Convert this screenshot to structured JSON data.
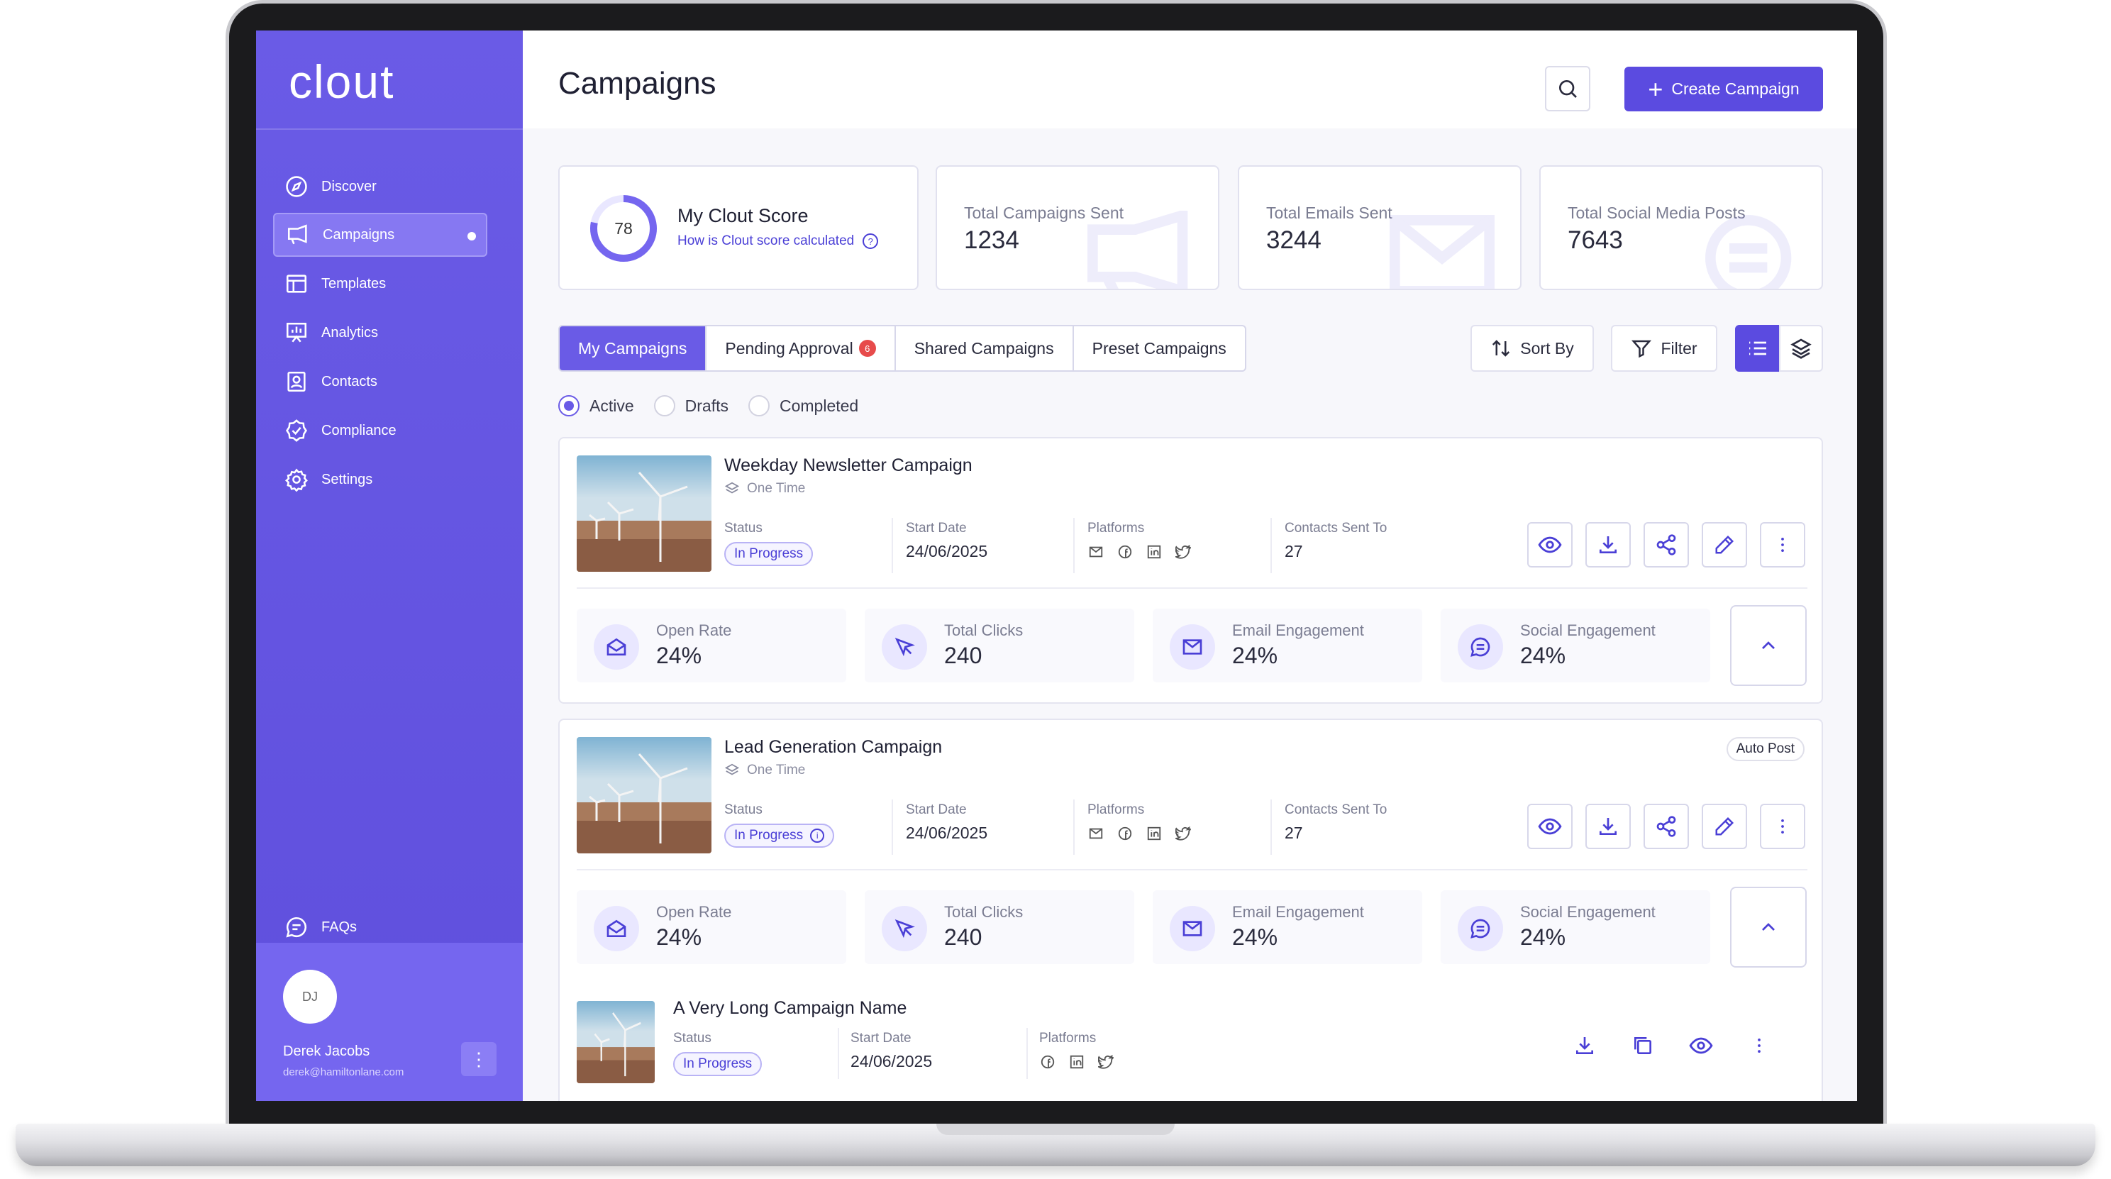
{
  "app": {
    "logo": "clout"
  },
  "sidebar": {
    "items": [
      {
        "label": "Discover",
        "icon": "compass-icon"
      },
      {
        "label": "Campaigns",
        "icon": "megaphone-icon",
        "active": true
      },
      {
        "label": "Templates",
        "icon": "layout-icon"
      },
      {
        "label": "Analytics",
        "icon": "presentation-chart-icon"
      },
      {
        "label": "Contacts",
        "icon": "contact-book-icon"
      },
      {
        "label": "Compliance",
        "icon": "badge-check-icon"
      },
      {
        "label": "Settings",
        "icon": "gear-icon"
      }
    ],
    "faqs": {
      "label": "FAQs",
      "icon": "chat-bubble-icon"
    },
    "user": {
      "initials": "DJ",
      "name": "Derek Jacobs",
      "email": "derek@hamiltonlane.com",
      "menu": "⋮"
    }
  },
  "header": {
    "title": "Campaigns",
    "create_label": "Create Campaign"
  },
  "score": {
    "value": "78",
    "percent": 78,
    "title": "My Clout Score",
    "link": "How is Clout score calculated",
    "help": "?"
  },
  "stats": [
    {
      "label": "Total Campaigns Sent",
      "value": "1234"
    },
    {
      "label": "Total Emails Sent",
      "value": "3244"
    },
    {
      "label": "Total Social Media Posts",
      "value": "7643"
    }
  ],
  "tabs": {
    "my": "My Campaigns",
    "pending": "Pending Approval",
    "pending_badge": "6",
    "shared": "Shared Campaigns",
    "preset": "Preset Campaigns"
  },
  "toolbar": {
    "sort": "Sort By",
    "filter": "Filter"
  },
  "filters": {
    "active": "Active",
    "drafts": "Drafts",
    "completed": "Completed",
    "selected": "Active"
  },
  "campaigns": [
    {
      "title": "Weekday Newsletter Campaign",
      "frequency": "One Time",
      "status_label": "Status",
      "status": "In Progress",
      "start_label": "Start Date",
      "start": "24/06/2025",
      "platforms_label": "Platforms",
      "contacts_label": "Contacts Sent To",
      "contacts": "27",
      "metrics": [
        {
          "label": "Open Rate",
          "value": "24%"
        },
        {
          "label": "Total Clicks",
          "value": "240"
        },
        {
          "label": "Email Engagement",
          "value": "24%"
        },
        {
          "label": "Social Engagement",
          "value": "24%"
        }
      ]
    },
    {
      "title": "Lead Generation Campaign",
      "frequency": "One Time",
      "tag": "Auto Post",
      "status_label": "Status",
      "status": "In Progress",
      "status_info": "i",
      "start_label": "Start Date",
      "start": "24/06/2025",
      "platforms_label": "Platforms",
      "contacts_label": "Contacts Sent To",
      "contacts": "27",
      "metrics": [
        {
          "label": "Open Rate",
          "value": "24%"
        },
        {
          "label": "Total Clicks",
          "value": "240"
        },
        {
          "label": "Email Engagement",
          "value": "24%"
        },
        {
          "label": "Social Engagement",
          "value": "24%"
        }
      ]
    },
    {
      "title": "A Very Long Campaign Name",
      "status_label": "Status",
      "status": "In Progress",
      "start_label": "Start Date",
      "start": "24/06/2025",
      "platforms_label": "Platforms"
    }
  ],
  "colors": {
    "brand": "#5b4be0",
    "sidebar": "#6a5be6",
    "accent_text": "#4a3fd6",
    "badge": "#e74b4b"
  }
}
